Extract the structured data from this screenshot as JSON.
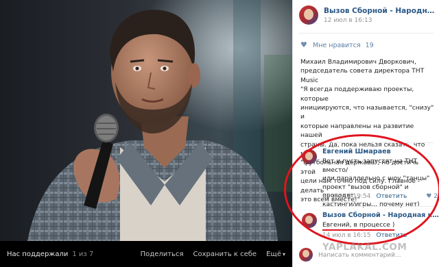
{
  "viewer": {
    "album": "Нас поддержали",
    "counter": "1 из 7",
    "actions": {
      "share": "Поделиться",
      "save": "Сохранить к себе",
      "more": "Ещё"
    }
  },
  "post": {
    "author": "Вызов Сборной - Народная коман...",
    "date": "12 июл в 16:13",
    "likes_label": "Мне нравится",
    "likes_count": "19",
    "text_lines": [
      "Михаил Владимирович Дворкович,",
      "председатель совета директора ТНТ Music",
      "\"Я всегда поддерживаю проекты, которые",
      "инициируются, что называется, \"снизу\" и",
      "которые направлены на развитие нашей",
      "страны. Да, пока нельзя сказать, что мы",
      "\"футбольная держава\", но достичь этой",
      "цели нам точно под силу. Главное - делать",
      "это всем вместе!\""
    ]
  },
  "comments": [
    {
      "author": "Евгений Шмараев",
      "text_lines": [
        "Вот и пусть запустят на ТНТ вместо/",
        "или параллельно с шоу \"танцы\"",
        "проект \"вызов сборной\" и проводят",
        "кастинги/игры... почему нет)"
      ],
      "date": "13 июл в 19:54",
      "reply": "Ответить",
      "likes": "2"
    },
    {
      "author": "Вызов Сборной - Народная коман...",
      "text_lines": [
        "Евгений, в процессе )"
      ],
      "date": "14 июл в 16:15",
      "reply": "Ответить"
    }
  ],
  "composer": {
    "placeholder": "Написать комментарий..."
  },
  "watermark": "YAPLAKAL.COM",
  "colors": {
    "link": "#2a5885",
    "highlight": "#e0141e",
    "viewer_bg": "#0d0d0d"
  },
  "icons": [
    "heart-icon",
    "avatar",
    "chevron-down-icon"
  ]
}
